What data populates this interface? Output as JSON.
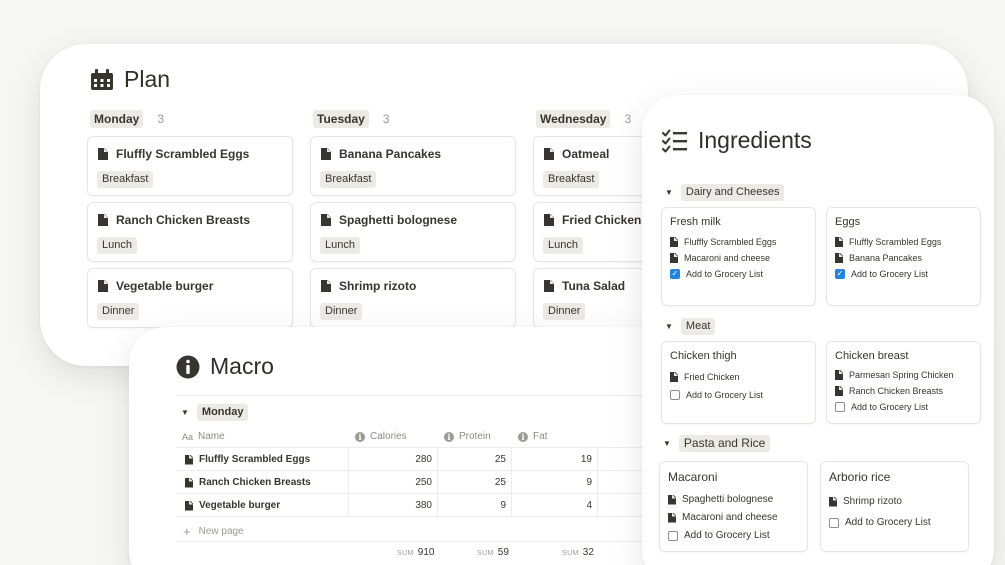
{
  "plan": {
    "title": "Plan",
    "columns": [
      {
        "day": "Monday",
        "count": "3",
        "cards": [
          {
            "title": "Fluffly Scrambled Eggs",
            "tag": "Breakfast"
          },
          {
            "title": "Ranch Chicken Breasts",
            "tag": "Lunch"
          },
          {
            "title": "Vegetable burger",
            "tag": "Dinner"
          }
        ]
      },
      {
        "day": "Tuesday",
        "count": "3",
        "cards": [
          {
            "title": "Banana Pancakes",
            "tag": "Breakfast"
          },
          {
            "title": "Spaghetti bolognese",
            "tag": "Lunch"
          },
          {
            "title": "Shrimp rizoto",
            "tag": "Dinner"
          }
        ]
      },
      {
        "day": "Wednesday",
        "count": "3",
        "cards": [
          {
            "title": "Oatmeal",
            "tag": "Breakfast"
          },
          {
            "title": "Fried Chicken",
            "tag": "Lunch"
          },
          {
            "title": "Tuna Salad",
            "tag": "Dinner"
          }
        ]
      }
    ]
  },
  "macro": {
    "title": "Macro",
    "group": "Monday",
    "headers": {
      "name": "Name",
      "name_prefix": "Aa",
      "calories": "Calories",
      "protein": "Protein",
      "fat": "Fat"
    },
    "rows": [
      {
        "name": "Fluffly Scrambled Eggs",
        "calories": "280",
        "protein": "25",
        "fat": "19"
      },
      {
        "name": "Ranch Chicken Breasts",
        "calories": "250",
        "protein": "25",
        "fat": "9"
      },
      {
        "name": "Vegetable burger",
        "calories": "380",
        "protein": "9",
        "fat": "4"
      }
    ],
    "new_page": "New page",
    "sum_label": "SUM",
    "sums": {
      "calories": "910",
      "protein": "59",
      "fat": "32"
    }
  },
  "ingredients": {
    "title": "Ingredients",
    "add_label": "Add to Grocery List",
    "groups": [
      {
        "name": "Dairy and Cheeses",
        "items": [
          {
            "name": "Fresh milk",
            "recipes": [
              "Fluffly Scrambled Eggs",
              "Macaroni and cheese"
            ],
            "checked": true
          },
          {
            "name": "Eggs",
            "recipes": [
              "Fluffly Scrambled Eggs",
              "Banana Pancakes"
            ],
            "checked": true
          }
        ]
      },
      {
        "name": "Meat",
        "items": [
          {
            "name": "Chicken thigh",
            "recipes": [
              "Fried Chicken"
            ],
            "checked": false
          },
          {
            "name": "Chicken breast",
            "recipes": [
              "Parmesan Spring Chicken",
              "Ranch Chicken Breasts"
            ],
            "checked": false
          }
        ]
      },
      {
        "name": "Pasta and Rice",
        "items": [
          {
            "name": "Macaroni",
            "recipes": [
              "Spaghetti bolognese",
              "Macaroni and cheese"
            ],
            "checked": false
          },
          {
            "name": "Arborio rice",
            "recipes": [
              "Shrimp rizoto"
            ],
            "checked": false
          }
        ]
      }
    ]
  },
  "colors": {
    "accent": "#2383e2",
    "tag_bg": "#ebeae6",
    "text": "#37352f",
    "muted": "#9b9a97"
  }
}
